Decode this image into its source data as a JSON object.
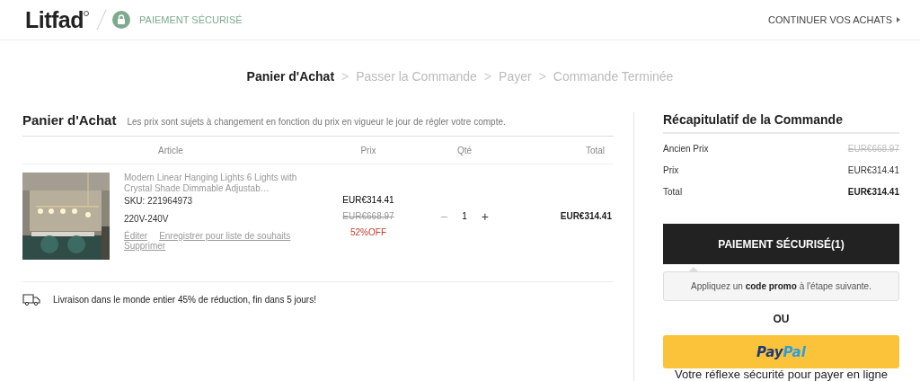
{
  "header": {
    "logo": "Litfad",
    "secure_label": "PAIEMENT SÉCURISÉ",
    "continue_link": "CONTINUER VOS ACHATS"
  },
  "steps": [
    {
      "label": "Panier d'Achat",
      "selected": true
    },
    {
      "label": "Passer la Commande",
      "selected": false
    },
    {
      "label": "Payer",
      "selected": false
    },
    {
      "label": "Commande Terminée",
      "selected": false
    }
  ],
  "step_separator": ">",
  "cart": {
    "title": "Panier d'Achat",
    "notice": "Les prix sont sujets à changement en fonction du prix en vigueur le jour de régler votre compte.",
    "columns": [
      "Article",
      "Prix",
      "Qté",
      "Total"
    ],
    "items": [
      {
        "kind": "picture",
        "name": "Modern Linear Hanging Lights 6 Lights with Crystal Shade Dimmable Adjustab…",
        "sku": "SKU: 221964973",
        "variant": "220V-240V",
        "actions": [
          "Éditer",
          "Enregistrer pour liste de souhaits",
          "Supprimer"
        ],
        "price": "EUR€314.41",
        "old_price": "EUR€668.97",
        "discount": "52%OFF",
        "minus": "−",
        "quantity": "1",
        "plus": "+",
        "total": "EUR€314.41"
      }
    ],
    "shipping_note": "Livraison dans le monde entier 45% de réduction, fin dans 5 jours!"
  },
  "summary": {
    "title": "Récapitulatif de la Commande",
    "rows": [
      {
        "kind": "old",
        "label": "Ancien Prix",
        "value": "EUR€668.97"
      },
      {
        "kind": "normal",
        "label": "Prix",
        "value": "EUR€314.41"
      },
      {
        "kind": "total",
        "label": "Total",
        "value": "EUR€314.41"
      }
    ],
    "checkout_button": "PAIEMENT SÉCURISÉ(1)",
    "promo_hint": "Appliquez un **code promo** à l'étape suivante.",
    "or_label": "OU",
    "paypal_logo": [
      "Pay",
      "Pal"
    ],
    "paypal_tagline": "Votre réflexe sécurité pour payer en ligne"
  }
}
